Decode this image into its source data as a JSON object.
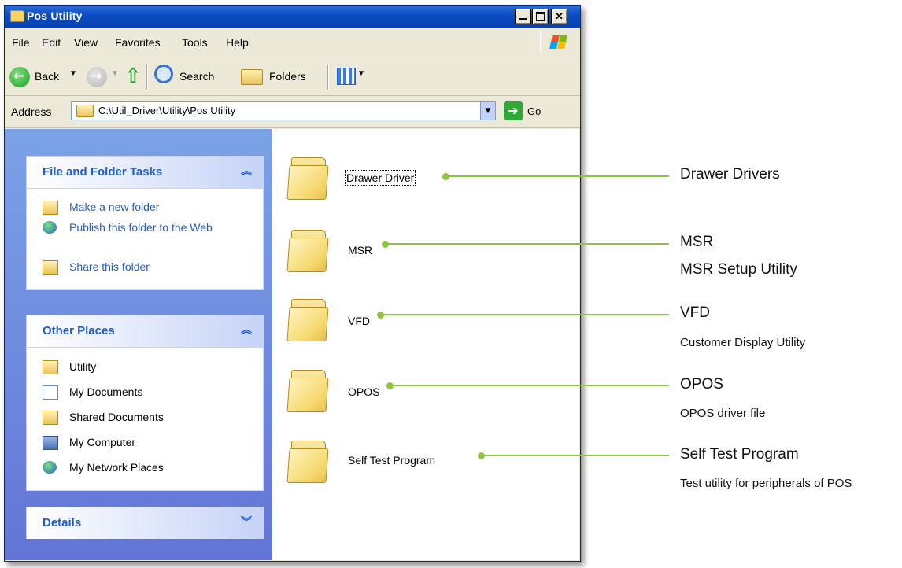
{
  "window": {
    "title": "Pos Utility"
  },
  "menu": [
    "File",
    "Edit",
    "View",
    "Favorites",
    "Tools",
    "Help"
  ],
  "toolbar": {
    "back_label": "Back",
    "search_label": "Search",
    "folders_label": "Folders"
  },
  "address": {
    "label": "Address",
    "path": "C:\\Util_Driver\\Utility\\Pos Utility",
    "go_label": "Go"
  },
  "tasks_panel": {
    "title": "File and Folder Tasks",
    "items": [
      "Make a new folder",
      "Publish this folder to the Web",
      "Share this folder"
    ]
  },
  "places_panel": {
    "title": "Other Places",
    "items": [
      "Utility",
      "My Documents",
      "Shared Documents",
      "My Computer",
      "My Network Places"
    ]
  },
  "details_panel": {
    "title": "Details"
  },
  "folders": [
    "Drawer Driver",
    "MSR",
    "VFD",
    "OPOS",
    "Self Test Program"
  ],
  "callouts": [
    {
      "title": "Drawer Drivers",
      "subtitle": ""
    },
    {
      "title": "MSR",
      "subtitle": "MSR Setup Utility"
    },
    {
      "title": "VFD",
      "subtitle": "Customer Display Utility"
    },
    {
      "title": "OPOS",
      "subtitle": "OPOS driver file"
    },
    {
      "title": "Self Test Program",
      "subtitle": "Test utility for peripherals of POS"
    }
  ],
  "colors": {
    "callout_green": "#8CC63F",
    "titlebar_blue": "#0A4BC4",
    "task_link_blue": "#215DC6"
  }
}
